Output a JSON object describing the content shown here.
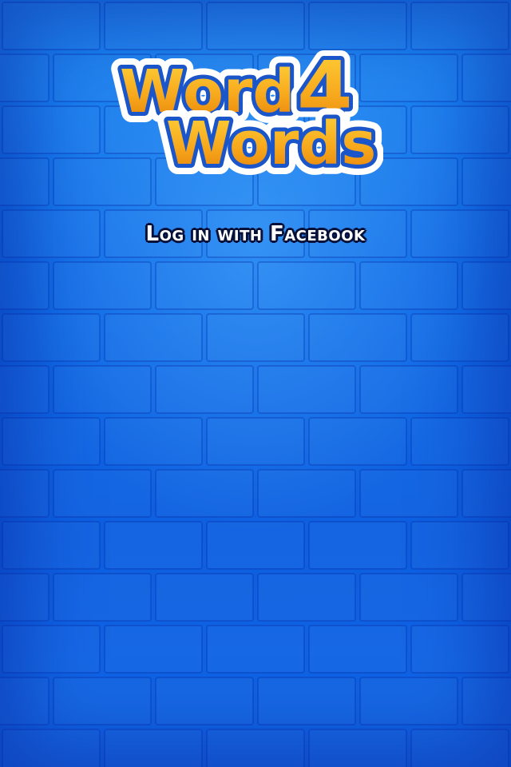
{
  "logo": {
    "word1": "Word",
    "number": "4",
    "word2": "Words"
  },
  "login": {
    "label": "Log in with Facebook"
  },
  "colors": {
    "background": "#0f6ae6",
    "logo_fill": "#f7a81c",
    "logo_outline": "#1a55c9",
    "logo_halo": "#ffffff",
    "login_text": "#ffffff",
    "login_outline": "#06113a"
  }
}
